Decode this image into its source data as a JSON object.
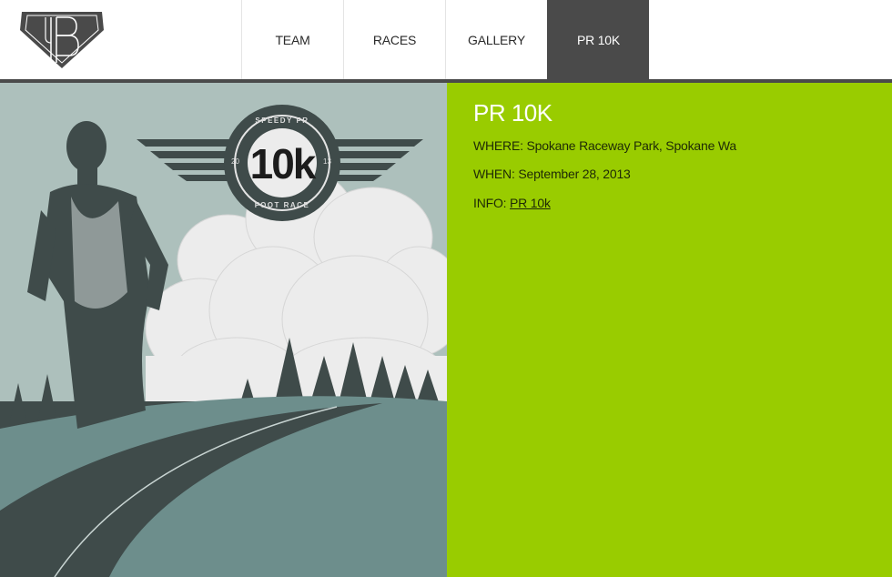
{
  "nav": {
    "items": [
      {
        "label": "TEAM"
      },
      {
        "label": "RACES"
      },
      {
        "label": "GALLERY"
      },
      {
        "label": "PR 10K",
        "active": true
      }
    ]
  },
  "hero": {
    "badge_top": "SPEEDY PR",
    "badge_main": "10k",
    "badge_bottom": "FOOT RACE",
    "badge_year_left": "20",
    "badge_year_right": "13"
  },
  "race": {
    "title": "PR 10K",
    "where_label": "WHERE:",
    "where_value": "Spokane Raceway Park, Spokane Wa",
    "when_label": "WHEN:",
    "when_value": "September 28, 2013",
    "info_label": "INFO:",
    "info_link": "PR 10k"
  },
  "colors": {
    "accent_green": "#99cc00",
    "nav_active": "#4a4a4a",
    "hero_sky": "#adc0bc",
    "hero_ground": "#6d8e8c",
    "hero_dark": "#3f4b4a"
  }
}
